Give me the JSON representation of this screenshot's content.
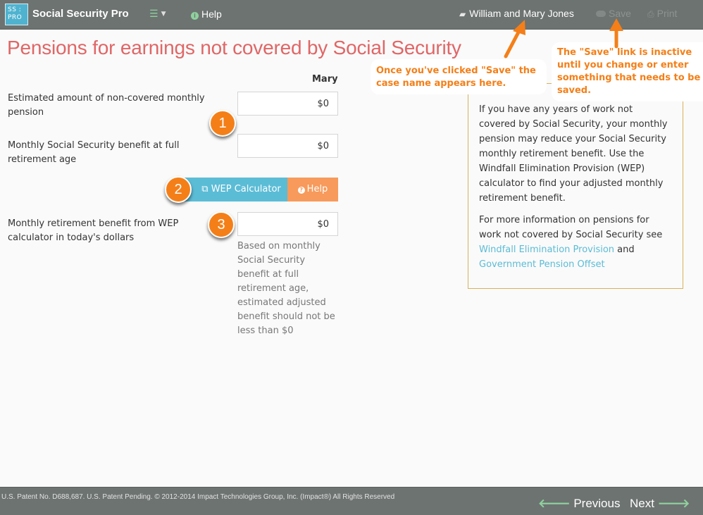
{
  "navbar": {
    "logo_line1": "SS :",
    "logo_line2": "PRO",
    "brand": "Social Security Pro",
    "menu_icon": "list-icon",
    "help_label": "Help",
    "case_name": "William and Mary Jones",
    "save_label": "Save",
    "print_label": "Print"
  },
  "page": {
    "title": "Pensions for earnings not covered by Social Security"
  },
  "form": {
    "column_header": "Mary",
    "rows": [
      {
        "label": "Estimated amount of non-covered monthly pension",
        "value": "$0"
      },
      {
        "label": "Monthly Social Security benefit at full retirement age",
        "value": "$0"
      },
      {
        "label": "Monthly retirement benefit from WEP calculator in today's dollars",
        "value": "$0"
      }
    ],
    "wep_button": "WEP Calculator",
    "help_button": "Help",
    "helper_text": "Based on monthly Social Security benefit at full retirement age, estimated adjusted benefit should not be less than $0"
  },
  "steps": [
    "1",
    "2",
    "3"
  ],
  "info": {
    "paragraph1": "If you have any years of work not covered by Social Security, your monthly pension may reduce your Social Security monthly retirement benefit. Use the Windfall Elimination Provision (WEP) calculator to find your adjusted monthly retirement benefit.",
    "paragraph2_prefix": "For more information on pensions for work not covered by Social Security see",
    "link1": "Windfall Elimination Provision",
    "and_text": "and",
    "link2": "Government Pension Offset"
  },
  "annotations": {
    "case_name_note": "Once you've clicked \"Save\" the case name appears here.",
    "save_note": "The \"Save\" link is inactive until you change or enter something that needs to be saved."
  },
  "footer": {
    "copyright": "U.S. Patent No. D688,687. U.S. Patent Pending. © 2012-2014 Impact Technologies Group, Inc. (Impact®) All Rights Reserved",
    "previous_label": "Previous",
    "next_label": "Next"
  },
  "colors": {
    "navbar_bg": "#6d7371",
    "title_red": "#e06666",
    "wep_blue": "#5bbcd6",
    "help_orange": "#f79a5b",
    "annotation_orange": "#f47f18",
    "info_border": "#d7b15b",
    "icon_green": "#8fd19e"
  }
}
